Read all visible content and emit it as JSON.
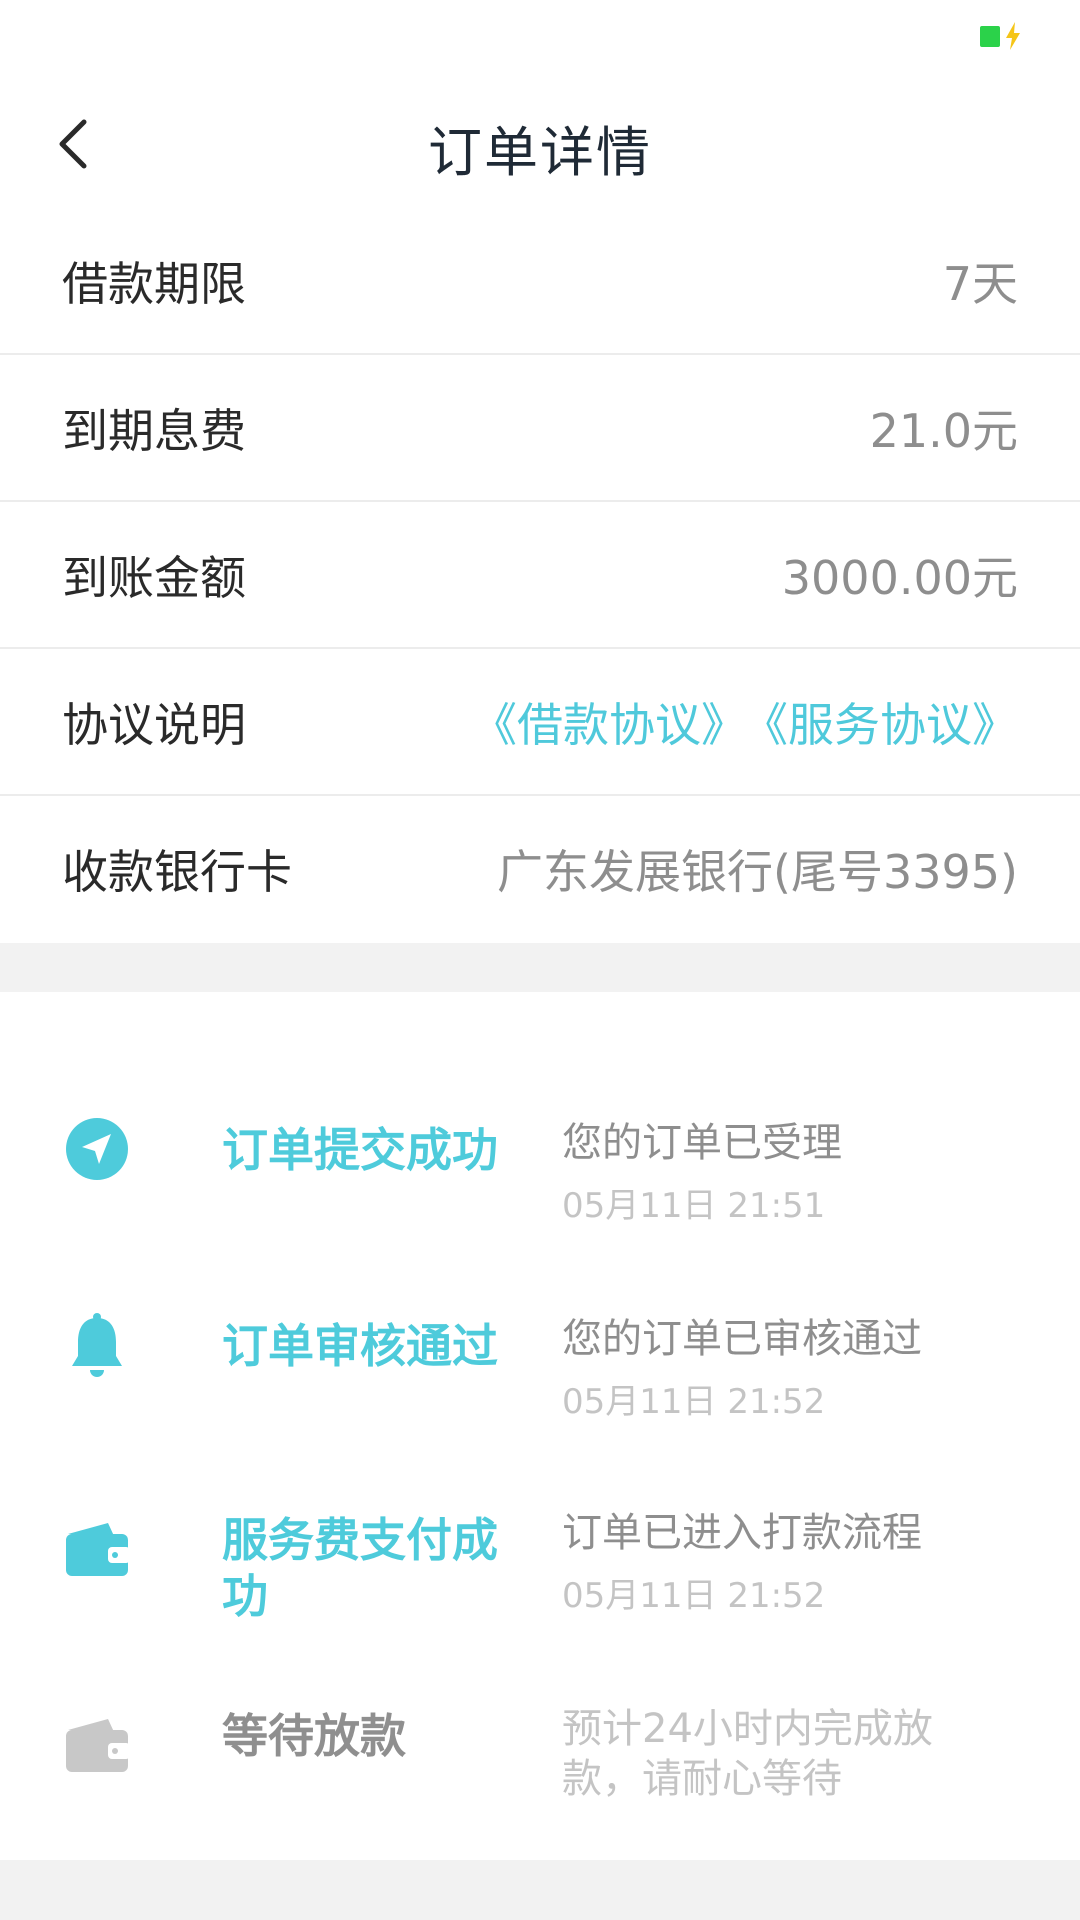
{
  "colors": {
    "accent": "#4ecbdb",
    "battery": "#2bd24a",
    "inactive": "#c8c8c8"
  },
  "header": {
    "title": "订单详情",
    "back_icon": "chevron-left-icon"
  },
  "info_rows": [
    {
      "label": "借款期限",
      "value": "7天"
    },
    {
      "label": "到期息费",
      "value": "21.0元"
    },
    {
      "label": "到账金额",
      "value": "3000.00元"
    },
    {
      "label": "协议说明",
      "links": [
        "《借款协议》",
        "《服务协议》"
      ]
    },
    {
      "label": "收款银行卡",
      "value": "广东发展银行(尾号3395)"
    }
  ],
  "timeline": [
    {
      "icon": "paper-plane-icon",
      "title": "订单提交成功",
      "desc": "您的订单已受理",
      "time": "05月11日 21:51",
      "status": "done"
    },
    {
      "icon": "bell-icon",
      "title": "订单审核通过",
      "desc": "您的订单已审核通过",
      "time": "05月11日 21:52",
      "status": "done"
    },
    {
      "icon": "wallet-icon",
      "title": "服务费支付成功",
      "desc": "订单已进入打款流程",
      "time": "05月11日 21:52",
      "status": "done"
    },
    {
      "icon": "wallet-icon",
      "title": "等待放款",
      "desc": "预计24小时内完成放款，请耐心等待",
      "time": "",
      "status": "pending"
    }
  ]
}
